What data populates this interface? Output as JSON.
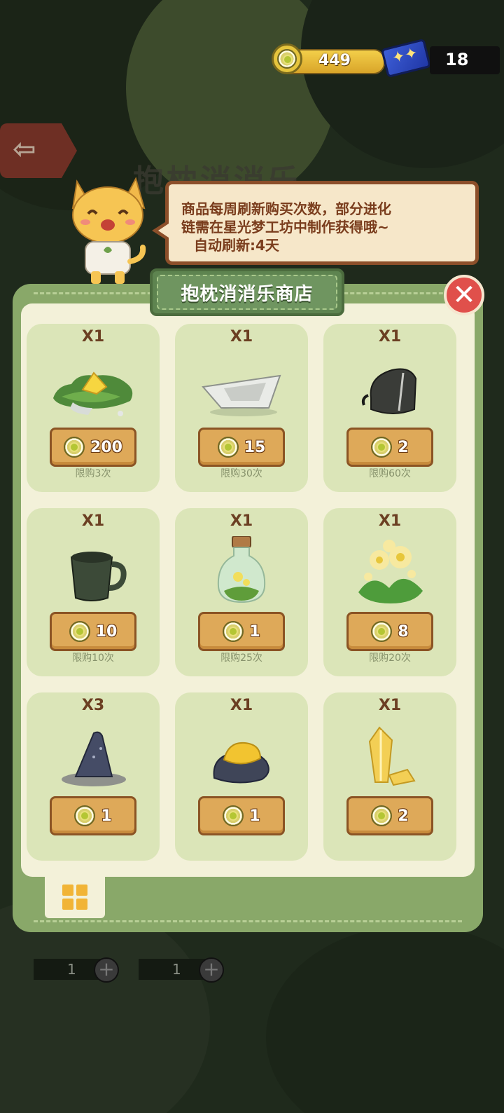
{
  "hud": {
    "coins": "449",
    "tickets": "18",
    "coin_icon": "flower-coin-icon",
    "ticket_icon": "star-ticket-icon"
  },
  "background": {
    "title": "抱枕消消乐"
  },
  "speech": {
    "line1": "商品每周刷新购买次数，部分进化",
    "line2": "链需在星光梦工坊中制作获得哦~",
    "line3": "自动刷新:4天"
  },
  "shop": {
    "title": "抱枕消消乐商店",
    "close_icon": "close-x-icon",
    "items": [
      {
        "qty": "X1",
        "price": "200",
        "limit": "限购3次",
        "icon": "grass-cheese-patch-icon"
      },
      {
        "qty": "X1",
        "price": "15",
        "limit": "限购30次",
        "icon": "paper-boat-icon"
      },
      {
        "qty": "X1",
        "price": "2",
        "limit": "限购60次",
        "icon": "backpack-icon"
      },
      {
        "qty": "X1",
        "price": "10",
        "limit": "限购10次",
        "icon": "mug-icon"
      },
      {
        "qty": "X1",
        "price": "1",
        "limit": "限购25次",
        "icon": "flower-bottle-icon"
      },
      {
        "qty": "X1",
        "price": "8",
        "limit": "限购20次",
        "icon": "yellow-flowers-icon"
      },
      {
        "qty": "X3",
        "price": "1",
        "limit": "",
        "icon": "dark-rock-icon"
      },
      {
        "qty": "X1",
        "price": "1",
        "limit": "",
        "icon": "gold-ore-icon"
      },
      {
        "qty": "X1",
        "price": "2",
        "limit": "",
        "icon": "crystal-icon"
      }
    ]
  },
  "bottom": {
    "counter1": "1",
    "counter2": "1"
  },
  "colors": {
    "panel": "#89a869",
    "inner": "#f3f1d9",
    "card": "#dbe5b8",
    "price_btn": "#dea959",
    "close": "#e0504b"
  }
}
